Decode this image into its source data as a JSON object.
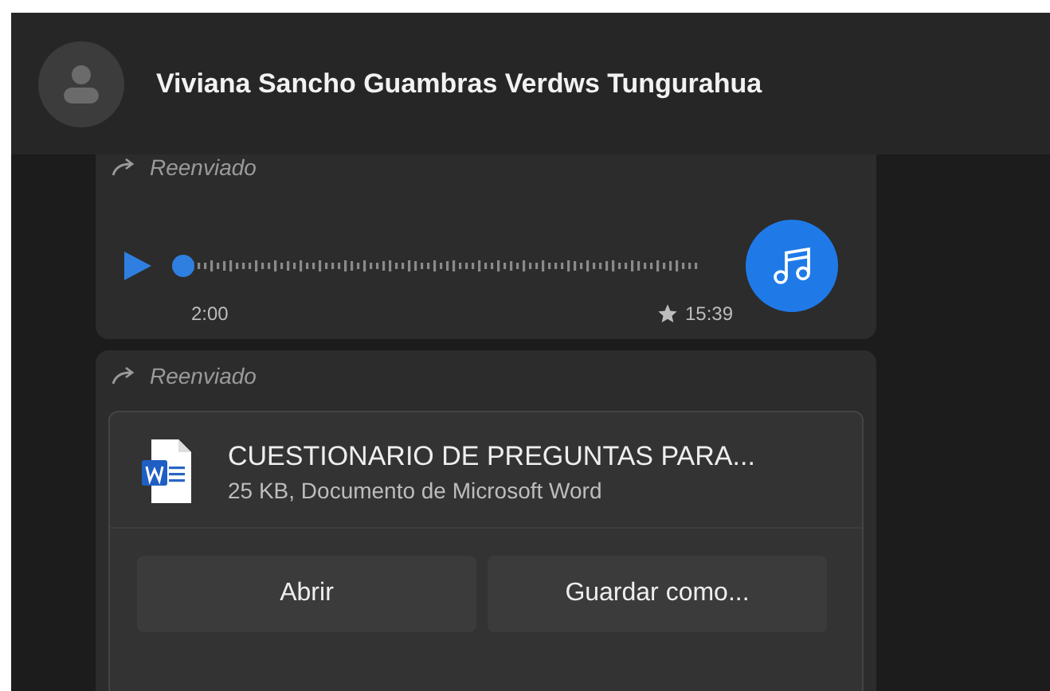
{
  "chat_header": {
    "contact_name": "Viviana Sancho Guambras Verdws Tungurahua"
  },
  "messages": [
    {
      "kind": "audio",
      "forwarded_label": "Reenviado",
      "duration": "2:00",
      "starred": true,
      "time": "15:39"
    },
    {
      "kind": "document",
      "forwarded_label": "Reenviado",
      "file_name": "CUESTIONARIO DE PREGUNTAS PARA...",
      "file_info": "25 KB, Documento de Microsoft Word",
      "buttons": [
        "Abrir",
        "Guardar como..."
      ]
    }
  ]
}
